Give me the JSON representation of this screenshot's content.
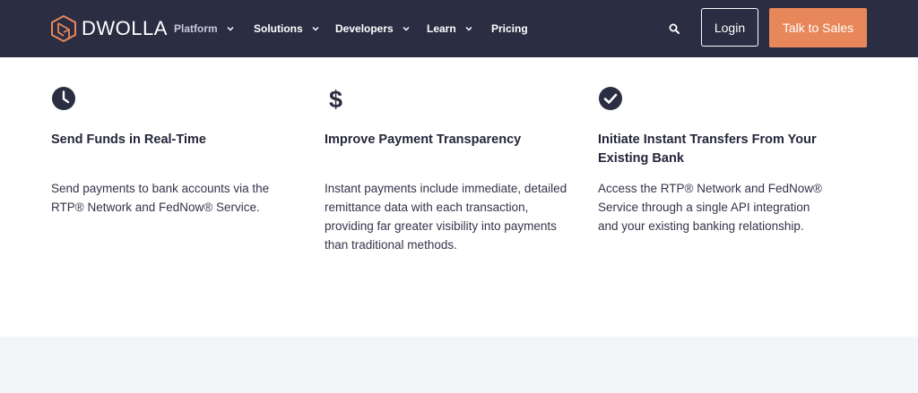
{
  "header": {
    "logo_text": "DWOLLA",
    "nav": [
      {
        "label": "Platform",
        "has_dropdown": true,
        "active": true
      },
      {
        "label": "Solutions",
        "has_dropdown": true
      },
      {
        "label": "Developers",
        "has_dropdown": true
      },
      {
        "label": "Learn",
        "has_dropdown": true
      },
      {
        "label": "Pricing",
        "has_dropdown": false
      }
    ],
    "login_label": "Login",
    "cta_label": "Talk to Sales",
    "colors": {
      "nav_bg": "#2b2d42",
      "accent": "#e8875a",
      "logo": "#e8875a"
    }
  },
  "features": [
    {
      "icon": "clock-icon",
      "title": "Send Funds in Real-Time",
      "description": "Send payments to bank accounts via the RTP® Network and FedNow® Service."
    },
    {
      "icon": "dollar-icon",
      "title": "Improve Payment Transparency",
      "description": "Instant payments include immediate, detailed remittance data with each transaction, providing far greater visibility into payments than traditional methods."
    },
    {
      "icon": "check-circle-icon",
      "title": "Initiate Instant Transfers From Your Existing Bank",
      "description": "Access the RTP® Network and FedNow® Service through a single API integration and your existing banking relationship."
    }
  ]
}
